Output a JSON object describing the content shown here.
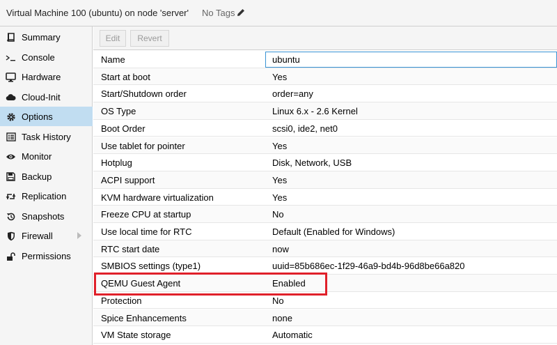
{
  "header": {
    "title": "Virtual Machine 100 (ubuntu) on node 'server'",
    "tags": "No Tags",
    "edit_icon": "pencil-icon"
  },
  "sidebar": {
    "items": [
      {
        "label": "Summary",
        "icon": "book-icon"
      },
      {
        "label": "Console",
        "icon": "terminal-icon"
      },
      {
        "label": "Hardware",
        "icon": "desktop-icon"
      },
      {
        "label": "Cloud-Init",
        "icon": "cloud-icon"
      },
      {
        "label": "Options",
        "icon": "gear-icon",
        "active": true
      },
      {
        "label": "Task History",
        "icon": "list-icon"
      },
      {
        "label": "Monitor",
        "icon": "eye-icon"
      },
      {
        "label": "Backup",
        "icon": "floppy-icon"
      },
      {
        "label": "Replication",
        "icon": "retweet-icon"
      },
      {
        "label": "Snapshots",
        "icon": "history-icon"
      },
      {
        "label": "Firewall",
        "icon": "shield-icon",
        "expandable": true
      },
      {
        "label": "Permissions",
        "icon": "unlock-icon"
      }
    ],
    "active_color": "#c1ddf1"
  },
  "toolbar": {
    "edit_label": "Edit",
    "revert_label": "Revert"
  },
  "options": {
    "rows": [
      {
        "key": "Name",
        "value": "ubuntu"
      },
      {
        "key": "Start at boot",
        "value": "Yes"
      },
      {
        "key": "Start/Shutdown order",
        "value": "order=any"
      },
      {
        "key": "OS Type",
        "value": "Linux 6.x - 2.6 Kernel"
      },
      {
        "key": "Boot Order",
        "value": "scsi0, ide2, net0"
      },
      {
        "key": "Use tablet for pointer",
        "value": "Yes"
      },
      {
        "key": "Hotplug",
        "value": "Disk, Network, USB"
      },
      {
        "key": "ACPI support",
        "value": "Yes"
      },
      {
        "key": "KVM hardware virtualization",
        "value": "Yes"
      },
      {
        "key": "Freeze CPU at startup",
        "value": "No"
      },
      {
        "key": "Use local time for RTC",
        "value": "Default (Enabled for Windows)"
      },
      {
        "key": "RTC start date",
        "value": "now"
      },
      {
        "key": "SMBIOS settings (type1)",
        "value": "uuid=85b686ec-1f29-46a9-bd4b-96d8be66a820"
      },
      {
        "key": "QEMU Guest Agent",
        "value": "Enabled"
      },
      {
        "key": "Protection",
        "value": "No"
      },
      {
        "key": "Spice Enhancements",
        "value": "none"
      },
      {
        "key": "VM State storage",
        "value": "Automatic"
      }
    ],
    "selected_border_color": "#3892d4",
    "highlight_color": "#e0202a"
  }
}
